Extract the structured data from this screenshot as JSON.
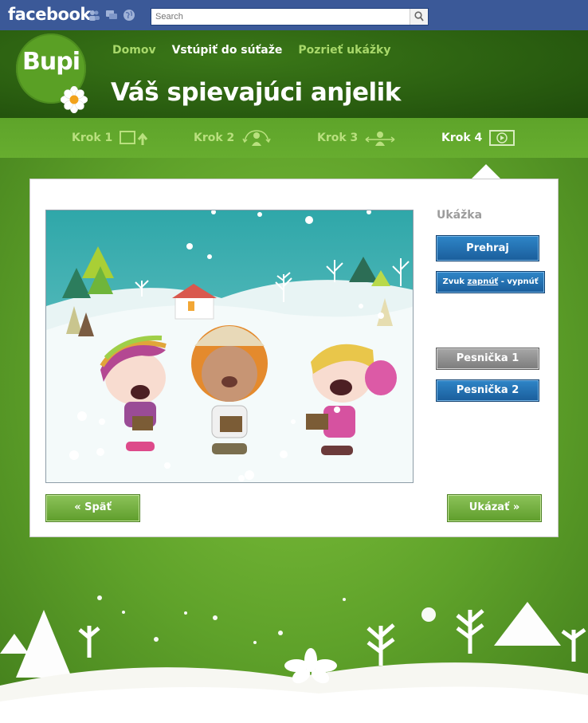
{
  "facebook": {
    "logo": "facebook",
    "icons": [
      "friends-icon",
      "messages-icon",
      "globe-icon"
    ],
    "search_placeholder": "Search"
  },
  "brand": {
    "logo_text": "Bupi"
  },
  "nav": {
    "items": [
      {
        "label": "Domov",
        "active": false
      },
      {
        "label": "Vstúpiť do súťaže",
        "active": true
      },
      {
        "label": "Pozrieť ukážky",
        "active": false
      }
    ]
  },
  "page_title": "Váš spievajúci anjelik",
  "steps": [
    {
      "label": "Krok 1",
      "icon": "upload-icon",
      "active": false
    },
    {
      "label": "Krok 2",
      "icon": "rotate-person-icon",
      "active": false
    },
    {
      "label": "Krok 3",
      "icon": "resize-person-icon",
      "active": false
    },
    {
      "label": "Krok 4",
      "icon": "play-icon",
      "active": true
    }
  ],
  "preview": {
    "label": "Ukážka",
    "play_button": "Prehraj",
    "sound": {
      "prefix": "Zvuk",
      "on": "zapnúť",
      "separator": "-",
      "off": "vypnúť"
    },
    "songs": [
      {
        "label": "Pesnička 1",
        "selected": false
      },
      {
        "label": "Pesnička 2",
        "selected": true
      }
    ]
  },
  "footer_buttons": {
    "back": "« Späť",
    "show": "Ukázať »"
  },
  "colors": {
    "facebook_blue": "#3b5998",
    "primary_green": "#5fa22a",
    "button_blue": "#1a5d9b",
    "button_grey": "#8a8a8a"
  }
}
